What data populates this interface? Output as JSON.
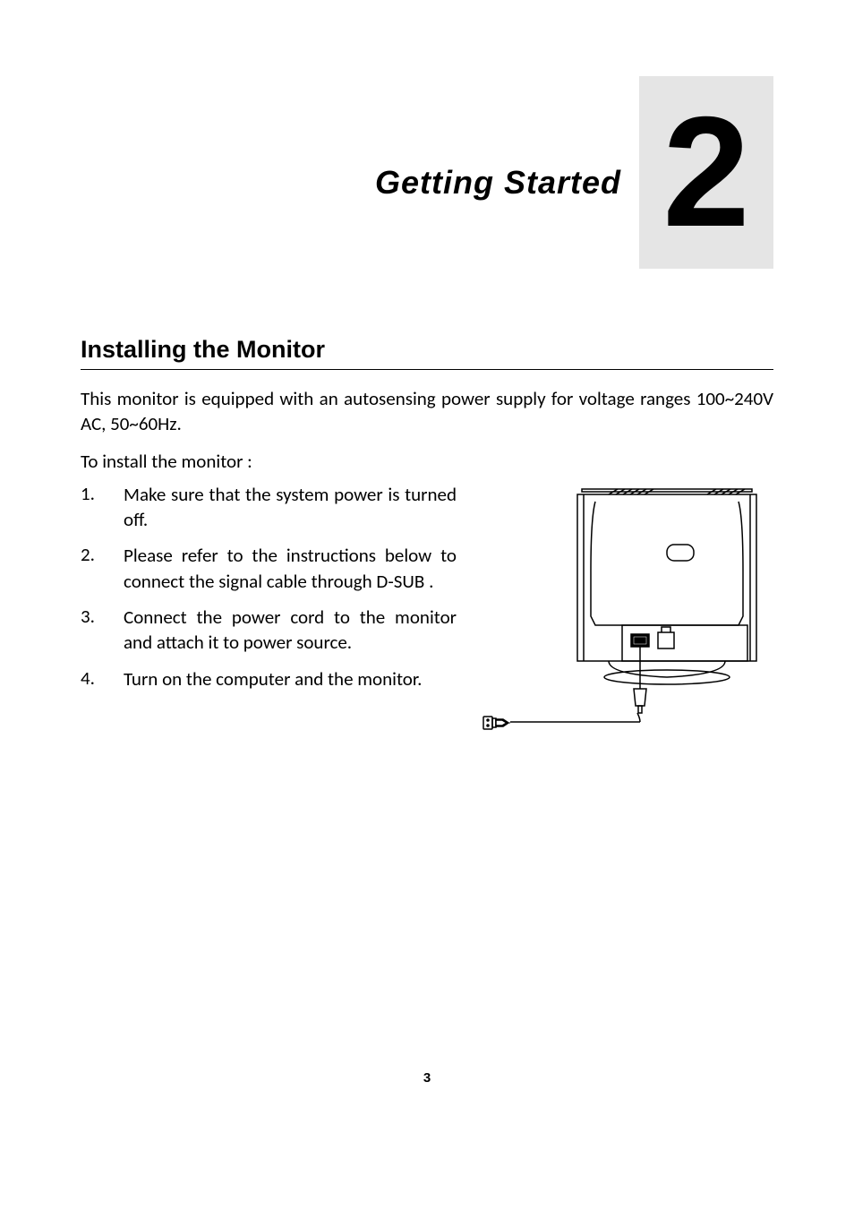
{
  "chapter": {
    "number": "2",
    "title": "Getting Started"
  },
  "section": {
    "heading": "Installing the Monitor",
    "intro": "This monitor is equipped with an autosensing power supply for voltage ranges 100~240V AC, 50~60Hz.",
    "lead": "To install the monitor :"
  },
  "steps": [
    {
      "num": "1.",
      "text": "Make sure that the system power is turned off."
    },
    {
      "num": "2.",
      "text": "Please refer to the instructions below to connect the signal cable through D-SUB ."
    },
    {
      "num": "3.",
      "text": "Connect the power cord to the monitor and attach it to power source."
    },
    {
      "num": "4.",
      "text": "Turn on the computer and the monitor."
    }
  ],
  "page_number": "3"
}
